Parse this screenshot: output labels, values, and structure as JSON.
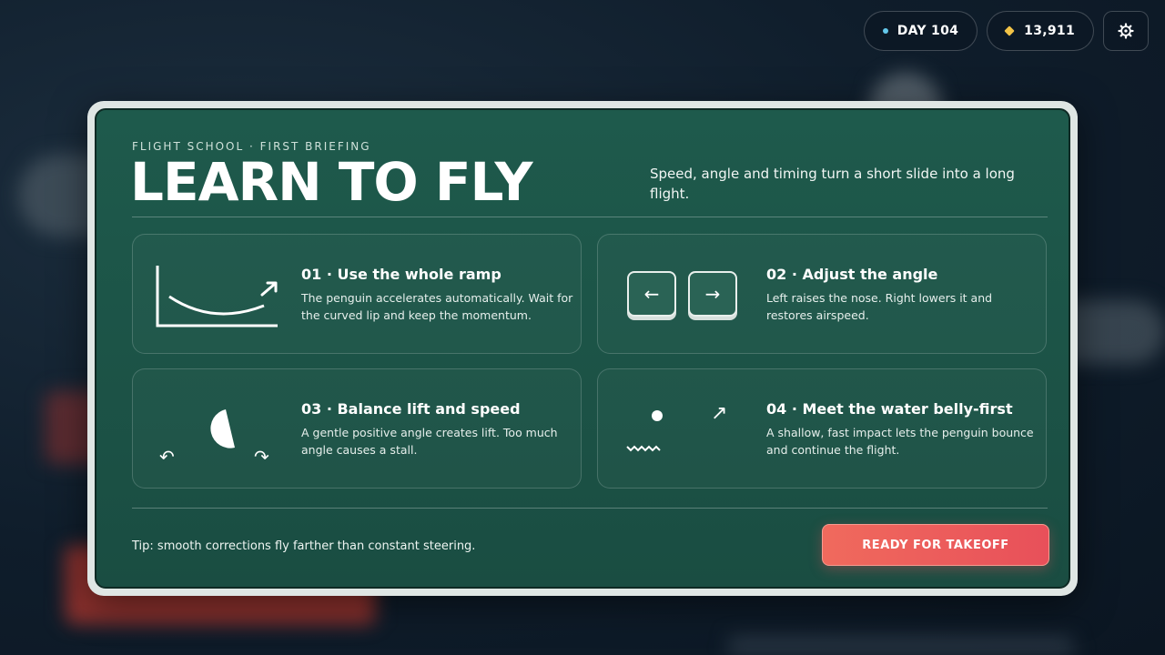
{
  "hud": {
    "day": "DAY 104",
    "coins": "13,911"
  },
  "briefing": {
    "eyebrow": "FLIGHT SCHOOL · FIRST BRIEFING",
    "title": "LEARN TO FLY",
    "intro": "Speed, angle and timing turn a short slide into a long flight.",
    "steps": [
      {
        "title": "01 · Use the whole ramp",
        "desc": "The penguin accelerates automatically. Wait for the curved lip and keep the momentum.",
        "icon": "ramp-icon"
      },
      {
        "title": "02 · Adjust the angle",
        "desc": "Left raises the nose. Right lowers it and restores airspeed.",
        "icon": "arrow-keys-icon",
        "keys": [
          "←",
          "→"
        ]
      },
      {
        "title": "03 · Balance lift and speed",
        "desc": "A gentle positive angle creates lift. Too much angle causes a stall.",
        "icon": "lift-balance-icon",
        "glyphs": [
          "↶",
          "↷"
        ]
      },
      {
        "title": "04 · Meet the water belly-first",
        "desc": "A shallow, fast impact lets the penguin bounce and continue the flight.",
        "icon": "water-bounce-icon",
        "glyphs": [
          "↗"
        ]
      }
    ],
    "tip": "Tip: smooth corrections fly farther than constant steering.",
    "cta": "READY FOR TAKEOFF"
  },
  "colors": {
    "panel": "#1e5a4c",
    "frame": "#dfe6e4",
    "cta": "#e8505a",
    "day_dot": "#63c7ea",
    "coin": "#f2c347"
  }
}
